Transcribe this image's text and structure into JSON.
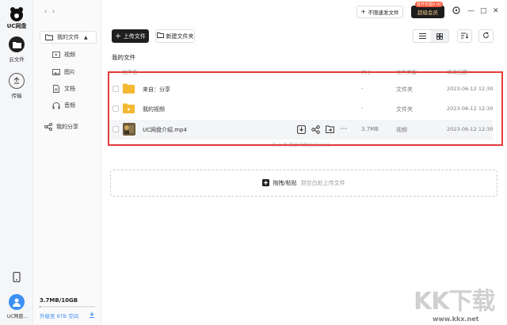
{
  "app": {
    "logo_text": "UC网盘"
  },
  "rail": {
    "items": [
      {
        "label": "云文件",
        "icon": "folder-icon",
        "active": true
      },
      {
        "label": "传输",
        "icon": "transfer-icon",
        "active": false
      }
    ],
    "bottom_icon": "phone-icon",
    "user_label": "UC网盘..."
  },
  "sidebar": {
    "nav_back": "‹",
    "nav_forward": "›",
    "my_files": "我的文件",
    "items": [
      {
        "label": "视频",
        "icon": "video-icon"
      },
      {
        "label": "图片",
        "icon": "image-icon"
      },
      {
        "label": "文档",
        "icon": "document-icon"
      },
      {
        "label": "音频",
        "icon": "audio-icon"
      }
    ],
    "my_share": "我的分享",
    "storage": "3.7MB/10GB",
    "storage_fraction": 0.0004,
    "upgrade": "升级至 6TB 空间"
  },
  "topbar": {
    "transfer_btn": "不限速发文件",
    "vip_badge": "首开仅需0.00",
    "vip_btn": "超级会员",
    "window_controls": [
      "—",
      "□",
      "✕"
    ]
  },
  "toolbar": {
    "upload": "上传文件",
    "new_folder": "新建文件夹"
  },
  "main": {
    "title": "我的文件",
    "columns": {
      "name": "文件名",
      "size": "大小",
      "type": "文件类型",
      "date": "修改日期 ▾"
    },
    "rows": [
      {
        "name": "来自：分享",
        "size": "-",
        "type": "文件夹",
        "date": "2023-06-12 12:30",
        "icon": "folder-icon"
      },
      {
        "name": "我的视频",
        "size": "-",
        "type": "文件夹",
        "date": "2023-06-12 12:30",
        "icon": "folder-video-icon"
      },
      {
        "name": "UC网盘介绍.mp4",
        "size": "3.7MB",
        "type": "视频",
        "date": "2023-06-12 12:30",
        "icon": "video-thumbnail"
      }
    ],
    "footer": "— 共 3 项 剩余可用空间10GB —",
    "dropzone": {
      "label": "拖拽/粘贴",
      "hint": "到空白处上传文件"
    }
  },
  "watermark": {
    "text": "KK下载",
    "url": "www.kkx.net"
  },
  "colors": {
    "accent": "#3b8ff5",
    "highlight": "#e33b3b",
    "folder": "#f5b833"
  }
}
